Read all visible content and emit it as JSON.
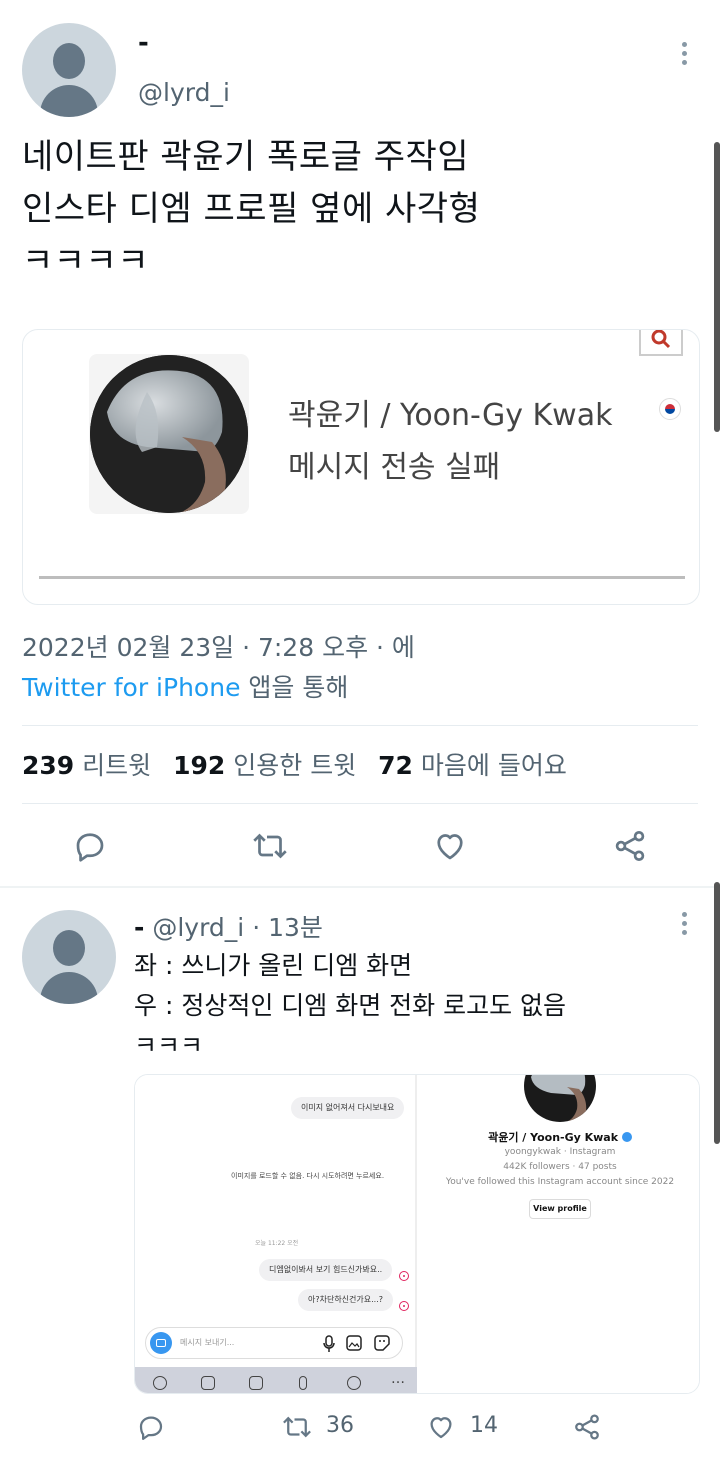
{
  "tweet": {
    "display_name": "-",
    "handle": "@lyrd_i",
    "text_lines": [
      "네이트판 곽윤기 폭로글 주작임",
      "인스타 디엠 프로필 옆에 사각형",
      "ㅋㅋㅋㅋ"
    ],
    "embedded_image": {
      "name_line": "곽윤기 / Yoon-Gy Kwak",
      "status_line": "메시지 전송 실패"
    },
    "date_line": "2022년 02월 23일 · 7:28 오후 · 에",
    "source_app": "Twitter for iPhone",
    "source_suffix": " 앱을 통해",
    "stats": {
      "retweets_count": "239",
      "retweets_label": "리트윗",
      "quotes_count": "192",
      "quotes_label": "인용한 트윗",
      "likes_count": "72",
      "likes_label": "마음에 들어요"
    }
  },
  "reply": {
    "display_name": "-",
    "handle": "@lyrd_i",
    "time": "· 13분",
    "text_lines": [
      "좌 : 쓰니가 올린 디엠 화면",
      "우 : 정상적인 디엠 화면 전화 로고도 없음",
      "ㅋㅋㅋ"
    ],
    "left_image": {
      "bubble_top": "이미지 없어져서 다시보내요",
      "center_notice": "이미지를 로드할 수 없음. 다시 시도하려면 누르세요.",
      "timestamp": "오늘 11:22 오전",
      "bubble_1": "디엠없이봐서 보기 힘드신가봐요..",
      "bubble_2": "아?차단하신건가요...?",
      "composer_placeholder": "메시지 보내기..."
    },
    "right_image": {
      "name": "곽윤기 / Yoon-Gy Kwak",
      "username": "yoongykwak · Instagram",
      "stats": "442K followers · 47 posts",
      "followed_note": "You've followed this Instagram account since 2022",
      "view_profile": "View profile"
    },
    "actions": {
      "retweet_count": "36",
      "like_count": "14"
    }
  },
  "colors": {
    "link_blue": "#1d9bf0",
    "muted_gray": "#536471",
    "icon_gray": "#657786",
    "instagram_blue": "#3897f0"
  },
  "icons": [
    "more-vertical-icon",
    "reply-icon",
    "retweet-icon",
    "like-icon",
    "share-icon",
    "search-icon",
    "verified-icon",
    "camera-icon",
    "mic-icon",
    "gallery-icon",
    "sticker-icon"
  ]
}
